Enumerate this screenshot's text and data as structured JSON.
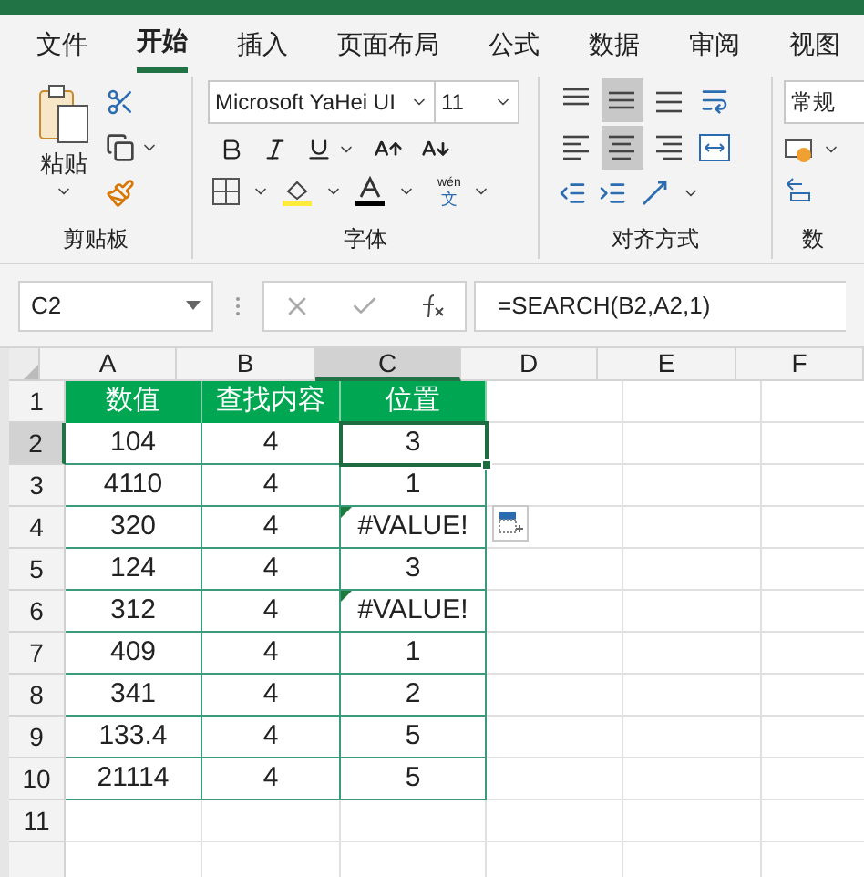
{
  "tabs": [
    {
      "label": "文件",
      "selected": false
    },
    {
      "label": "开始",
      "selected": true
    },
    {
      "label": "插入",
      "selected": false
    },
    {
      "label": "页面布局",
      "selected": false
    },
    {
      "label": "公式",
      "selected": false
    },
    {
      "label": "数据",
      "selected": false
    },
    {
      "label": "审阅",
      "selected": false
    },
    {
      "label": "视图",
      "selected": false
    }
  ],
  "ribbon": {
    "clipboard": {
      "paste_label": "粘贴",
      "group_label": "剪贴板"
    },
    "font": {
      "font_name": "Microsoft YaHei UI",
      "font_size": "11",
      "phonetic_top": "wén",
      "phonetic_bottom": "文",
      "group_label": "字体"
    },
    "alignment": {
      "buttons": [
        {
          "kind": "top",
          "selected": false
        },
        {
          "kind": "middle",
          "selected": true
        },
        {
          "kind": "bottom",
          "selected": false
        },
        {
          "kind": "wrap",
          "selected": false
        },
        {
          "kind": "left",
          "selected": false
        },
        {
          "kind": "center",
          "selected": true
        },
        {
          "kind": "right",
          "selected": false
        },
        {
          "kind": "merge",
          "selected": false
        }
      ],
      "group_label": "对齐方式"
    },
    "number": {
      "format": "常规",
      "group_label": "数"
    }
  },
  "formula_bar": {
    "name_box": "C2",
    "formula": "=SEARCH(B2,A2,1)"
  },
  "sheet": {
    "columns": [
      {
        "label": "A",
        "selected": false
      },
      {
        "label": "B",
        "selected": false
      },
      {
        "label": "C",
        "selected": true
      },
      {
        "label": "D",
        "selected": false
      },
      {
        "label": "E",
        "selected": false
      },
      {
        "label": "F",
        "selected": false
      }
    ],
    "rows": [
      {
        "header": "1",
        "selected": false,
        "kind": "heading",
        "cells": [
          {
            "text": "数值",
            "selected": false,
            "error_flag": false
          },
          {
            "text": "查找内容",
            "selected": false,
            "error_flag": false
          },
          {
            "text": "位置",
            "selected": false,
            "error_flag": false
          }
        ]
      },
      {
        "header": "2",
        "selected": true,
        "kind": "data",
        "cells": [
          {
            "text": "104",
            "selected": false,
            "error_flag": false
          },
          {
            "text": "4",
            "selected": false,
            "error_flag": false
          },
          {
            "text": "3",
            "selected": true,
            "error_flag": false
          }
        ]
      },
      {
        "header": "3",
        "selected": false,
        "kind": "data",
        "cells": [
          {
            "text": "4110",
            "selected": false,
            "error_flag": false
          },
          {
            "text": "4",
            "selected": false,
            "error_flag": false
          },
          {
            "text": "1",
            "selected": false,
            "error_flag": false
          }
        ]
      },
      {
        "header": "4",
        "selected": false,
        "kind": "data",
        "cells": [
          {
            "text": "320",
            "selected": false,
            "error_flag": false
          },
          {
            "text": "4",
            "selected": false,
            "error_flag": false
          },
          {
            "text": "#VALUE!",
            "selected": false,
            "error_flag": true
          }
        ]
      },
      {
        "header": "5",
        "selected": false,
        "kind": "data",
        "cells": [
          {
            "text": "124",
            "selected": false,
            "error_flag": false
          },
          {
            "text": "4",
            "selected": false,
            "error_flag": false
          },
          {
            "text": "3",
            "selected": false,
            "error_flag": false
          }
        ]
      },
      {
        "header": "6",
        "selected": false,
        "kind": "data",
        "cells": [
          {
            "text": "312",
            "selected": false,
            "error_flag": false
          },
          {
            "text": "4",
            "selected": false,
            "error_flag": false
          },
          {
            "text": "#VALUE!",
            "selected": false,
            "error_flag": true
          }
        ]
      },
      {
        "header": "7",
        "selected": false,
        "kind": "data",
        "cells": [
          {
            "text": "409",
            "selected": false,
            "error_flag": false
          },
          {
            "text": "4",
            "selected": false,
            "error_flag": false
          },
          {
            "text": "1",
            "selected": false,
            "error_flag": false
          }
        ]
      },
      {
        "header": "8",
        "selected": false,
        "kind": "data",
        "cells": [
          {
            "text": "341",
            "selected": false,
            "error_flag": false
          },
          {
            "text": "4",
            "selected": false,
            "error_flag": false
          },
          {
            "text": "2",
            "selected": false,
            "error_flag": false
          }
        ]
      },
      {
        "header": "9",
        "selected": false,
        "kind": "data",
        "cells": [
          {
            "text": "133.4",
            "selected": false,
            "error_flag": false
          },
          {
            "text": "4",
            "selected": false,
            "error_flag": false
          },
          {
            "text": "5",
            "selected": false,
            "error_flag": false
          }
        ]
      },
      {
        "header": "10",
        "selected": false,
        "kind": "data",
        "cells": [
          {
            "text": "21114",
            "selected": false,
            "error_flag": false
          },
          {
            "text": "4",
            "selected": false,
            "error_flag": false
          },
          {
            "text": "5",
            "selected": false,
            "error_flag": false
          }
        ]
      }
    ],
    "empty_rows": [
      "11"
    ]
  }
}
